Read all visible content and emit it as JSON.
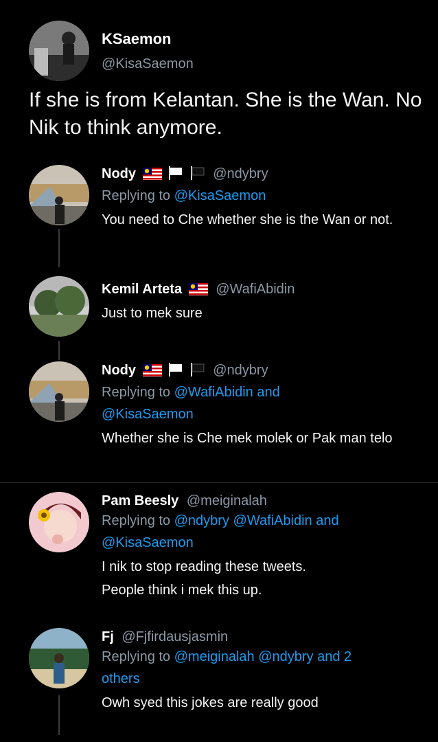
{
  "main_tweet": {
    "name": "KSaemon",
    "handle": "@KisaSaemon",
    "text": "If she is from Kelantan. She is the Wan. No Nik to think anymore."
  },
  "replies": [
    {
      "name": "Nody",
      "handle": "@ndybry",
      "replying_prefix": "Replying to",
      "mentions": [
        "@KisaSaemon"
      ],
      "text": "You need to Che whether she is the Wan or not."
    },
    {
      "name": "Kemil Arteta",
      "handle": "@WafiAbidin",
      "text": "Just to mek sure"
    },
    {
      "name": "Nody",
      "handle": "@ndybry",
      "replying_prefix": "Replying to",
      "mentions_line1": "@WafiAbidin and",
      "mentions_line2": "@KisaSaemon",
      "text": "Whether she is Che mek molek or Pak man telo"
    },
    {
      "name": "Pam Beesly",
      "handle": "@meiginalah",
      "replying_prefix": "Replying to",
      "mentions_line1": "@ndybry @WafiAbidin and",
      "mentions_line2": "@KisaSaemon",
      "text_line1": "I nik to stop reading these tweets.",
      "text_line2": "People think i mek this up."
    },
    {
      "name": "Fj",
      "handle": "@Fjfirdausjasmin",
      "replying_prefix": "Replying to",
      "mentions_line1": "@meiginalah @ndybry and 2",
      "mentions_line2": "others",
      "text": "Owh syed this jokes are really good"
    }
  ],
  "colors": {
    "background": "#000000",
    "mention": "#1d9bf0",
    "muted": "#8b98a5",
    "text": "#f4f4f4"
  },
  "icons": [
    "malaysia-flag-icon",
    "white-flag-icon",
    "black-flag-icon"
  ]
}
